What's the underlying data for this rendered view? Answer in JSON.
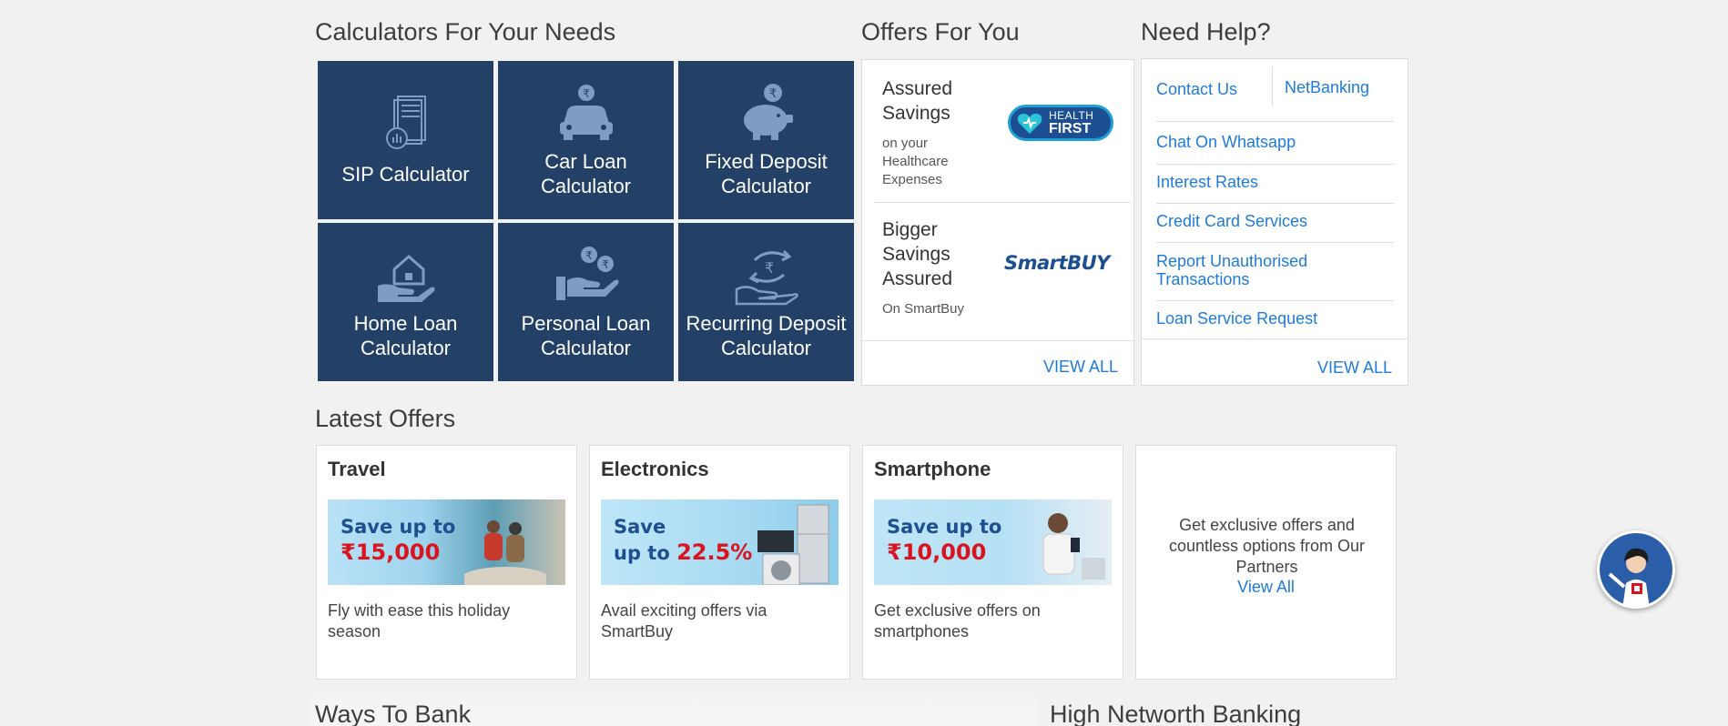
{
  "calculators": {
    "title": "Calculators For Your Needs",
    "items": [
      {
        "label": "SIP Calculator",
        "icon": "document-chart-icon"
      },
      {
        "label": "Car Loan\nCalculator",
        "icon": "car-rupee-icon"
      },
      {
        "label": "Fixed Deposit\nCalculator",
        "icon": "piggy-bank-icon"
      },
      {
        "label": "Home Loan\nCalculator",
        "icon": "house-hand-icon"
      },
      {
        "label": "Personal Loan\nCalculator",
        "icon": "coins-hand-icon"
      },
      {
        "label": "Recurring Deposit\nCalculator",
        "icon": "recurring-rupee-icon"
      }
    ]
  },
  "offers_for_you": {
    "title": "Offers For You",
    "items": [
      {
        "title": "Assured\nSavings",
        "desc": "on your\nHealthcare\nExpenses",
        "logo_line1": "HEALTH",
        "logo_line2": "FIRST"
      },
      {
        "title": "Bigger\nSavings\nAssured",
        "desc": "On SmartBuy",
        "logo_text": "SmartBUY"
      }
    ],
    "view_all": "VIEW ALL"
  },
  "help": {
    "title": "Need Help?",
    "tabs": [
      "Contact Us",
      "NetBanking"
    ],
    "links": [
      "Chat On Whatsapp",
      "Interest Rates",
      "Credit Card Services",
      "Report Unauthorised Transactions",
      "Loan Service Request"
    ],
    "view_all": "VIEW ALL"
  },
  "latest_offers": {
    "title": "Latest Offers",
    "cards": [
      {
        "category": "Travel",
        "banner_line1": "Save up to",
        "banner_amount": "₹15,000",
        "desc": "Fly with ease this holiday season"
      },
      {
        "category": "Electronics",
        "banner_line1": "Save",
        "banner_line2": "up to",
        "banner_amount": "22.5%",
        "desc": "Avail exciting offers via SmartBuy"
      },
      {
        "category": "Smartphone",
        "banner_line1": "Save up to",
        "banner_amount": "₹10,000",
        "desc": "Get exclusive offers on smartphones"
      }
    ],
    "partner_text": "Get exclusive offers and countless options from Our Partners",
    "partner_link": "View All"
  },
  "footer_sections": {
    "ways_to_bank": "Ways To Bank",
    "high_networth": "High Networth Banking"
  },
  "colors": {
    "tile_bg": "#234067",
    "link": "#1e7bd9",
    "accent_red": "#d9141e"
  }
}
